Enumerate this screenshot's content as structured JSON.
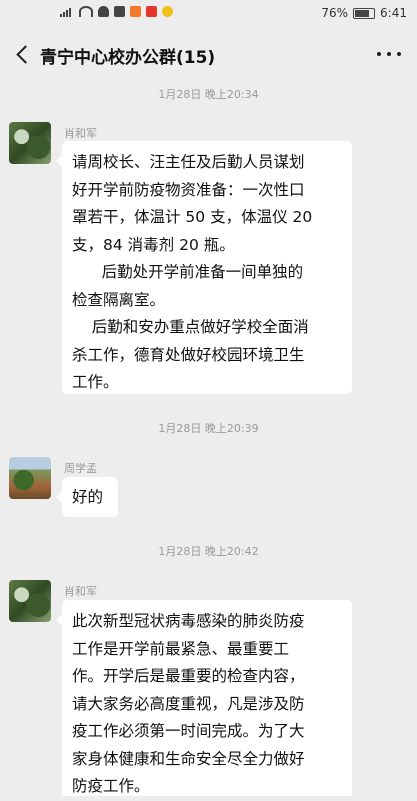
{
  "status_bar": {
    "battery": "76%",
    "time": "6:41"
  },
  "header": {
    "title": "青宁中心校办公群(15)",
    "back_icon": "chevron-left-icon",
    "more_icon": "more-dots-icon"
  },
  "messages": [
    {
      "timestamp": "1月28日 晚上20:34",
      "sender": "肖和军",
      "text": "请周校长、汪主任及后勤人员谋划\n好开学前防疫物资准备：一次性口\n罩若干，体温计 50 支，体温仪 20\n支，84 消毒剂 20 瓶。\n      后勤处开学前准备一间单独的\n检查隔离室。\n    后勤和安办重点做好学校全面消\n杀工作，德育处做好校园环境卫生\n工作。"
    },
    {
      "timestamp": "1月28日 晚上20:39",
      "sender": "周学孟",
      "text": "好的"
    },
    {
      "timestamp": "1月28日 晚上20:42",
      "sender": "肖和军",
      "text": "此次新型冠状病毒感染的肺炎防疫\n工作是开学前最紧急、最重要工\n作。开学后是最重要的检查内容，\n请大家务必高度重视，凡是涉及防\n疫工作必须第一时间完成。为了大\n家身体健康和生命安全尽全力做好\n防疫工作。"
    }
  ]
}
